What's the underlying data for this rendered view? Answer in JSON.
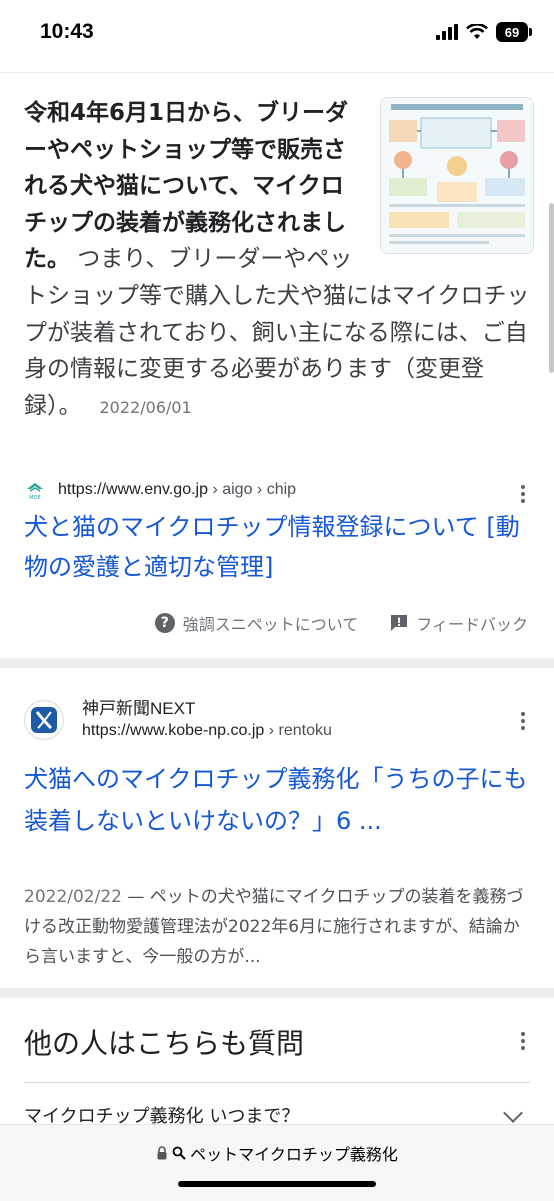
{
  "status_bar": {
    "time": "10:43",
    "battery": "69"
  },
  "featured_snippet": {
    "bold_text": "令和4年6月1日から、ブリーダーやペットショップ等で販売される犬や猫について、マイクロチップの装着が義務化されました。",
    "text": " つまり、ブリーダーやペットショップ等で購入した犬や猫にはマイクロチップが装着されており、飼い主になる際には、ご自身の情報に変更する必要があります（変更登録）。",
    "date": "2022/06/01",
    "source_url": "https://www.env.go.jp",
    "source_crumb": " › aigo › chip",
    "favicon_label": "MOE",
    "title": "犬と猫のマイクロチップ情報登録について [動物の愛護と適切な管理]",
    "about_label": "強調スニペットについて",
    "feedback_label": "フィードバック"
  },
  "result2": {
    "site_name": "神戸新聞NEXT",
    "url": "https://www.kobe-np.co.jp",
    "crumb": " › rentoku",
    "title": "犬猫へのマイクロチップ義務化「うちの子にも装着しないといけないの？」6 ...",
    "date": "2022/02/22",
    "snippet": " — ペットの犬や猫にマイクロチップの装着を義務づける改正動物愛護管理法が2022年6月に施行されますが、結論から言いますと、今一般の方が..."
  },
  "people_also_ask": {
    "title": "他の人はこちらも質問",
    "first_question": "マイクロチップ義務化 いつまで？"
  },
  "bottom_bar": {
    "address": "ペットマイクロチップ義務化"
  }
}
